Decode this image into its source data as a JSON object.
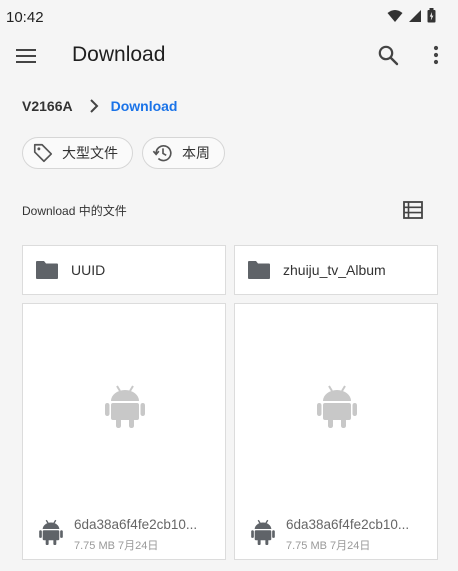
{
  "status": {
    "time": "10:42"
  },
  "header": {
    "title": "Download"
  },
  "breadcrumb": {
    "root": "V2166A",
    "current": "Download"
  },
  "chips": [
    {
      "label": "大型文件",
      "icon": "tag-icon"
    },
    {
      "label": "本周",
      "icon": "history-icon"
    }
  ],
  "section": {
    "label": "Download 中的文件"
  },
  "folders": [
    {
      "name": "UUID",
      "icon": "folder-icon"
    },
    {
      "name": "zhuiju_tv_Album",
      "icon": "folder-icon"
    }
  ],
  "files": [
    {
      "name": "6da38a6f4fe2cb10...",
      "info": "7.75 MB 7月24日",
      "icon": "android-icon"
    },
    {
      "name": "6da38a6f4fe2cb10...",
      "info": "7.75 MB 7月24日",
      "icon": "android-icon"
    }
  ],
  "colors": {
    "accent": "#1a73e8",
    "background": "#f5f5f5",
    "card": "#ffffff",
    "icon_gray": "#5f6368",
    "preview_gray": "#c8c8c8"
  }
}
